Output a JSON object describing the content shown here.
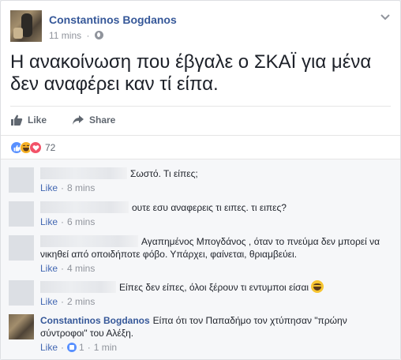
{
  "post": {
    "author": "Constantinos Bogdanos",
    "time": "11 mins",
    "dot": "·",
    "text": "Η ανακοίνωση που έβγαλε ο ΣΚΑΪ για μένα δεν αναφέρει καν τί είπα.",
    "like_label": "Like",
    "share_label": "Share",
    "reactions_count": "72",
    "icons": {
      "privacy": "globe-icon",
      "menu": "chevron-down-icon",
      "like": "thumbs-up-icon",
      "share": "share-arrow-icon"
    },
    "colors": {
      "link": "#365899",
      "like": "#5890ff",
      "haha": "#f7b125",
      "love": "#f25268"
    }
  },
  "comments": [
    {
      "text": "Σωστό. Τι είπες;",
      "like": "Like",
      "dot": "·",
      "time": "8 mins"
    },
    {
      "text": "ουτε εσυ αναφερεις τι ειπες. τι ειπες?",
      "like": "Like",
      "dot": "·",
      "time": "6 mins"
    },
    {
      "text_line1": "Αγαπημένος Μπογδάνος , όταν το πνεύμα δεν μπορεί να",
      "text_line2": "νικηθεί από οποιδήποτε φόβο. Υπάρχει, φαίνεται, θριαμβεύει.",
      "like": "Like",
      "dot": "·",
      "time": "4 mins"
    },
    {
      "text": "Είπες δεν είπες, όλοι ξέρουν τι εντυμποι είσαι",
      "like": "Like",
      "dot": "·",
      "time": "2 mins"
    },
    {
      "author": "Constantinos Bogdanos",
      "text_line1": "Είπα ότι τον Παπαδήμο τον χτύπησαν \"πρώην",
      "text_line2": "σύντροφοι\" του Αλέξη.",
      "like": "Like",
      "dot": "·",
      "like_count": "1",
      "time": "1 min"
    }
  ]
}
